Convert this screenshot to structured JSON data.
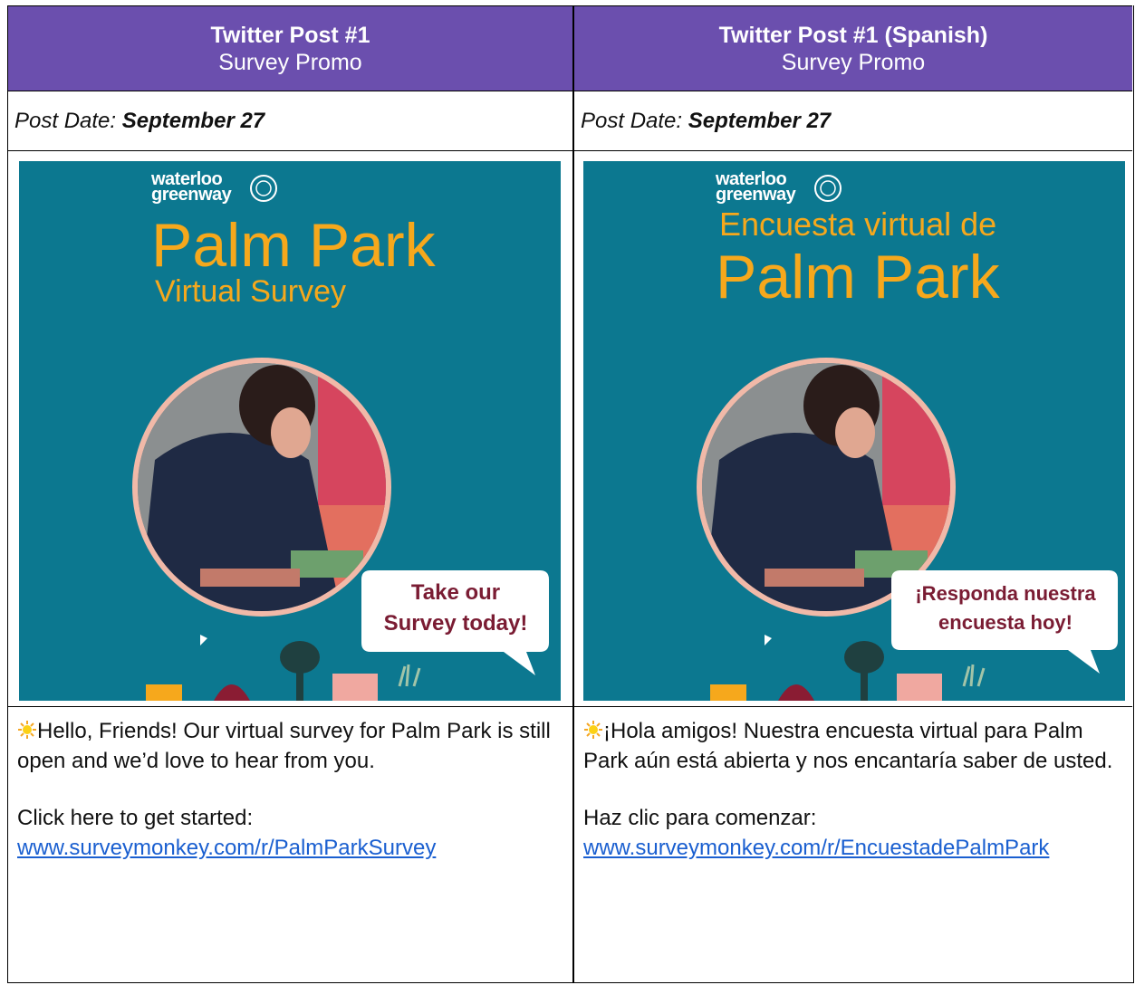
{
  "left": {
    "header_title": "Twitter Post #1",
    "header_subtitle": "Survey Promo",
    "date_label": "Post Date: ",
    "date_value": "September 27",
    "poster": {
      "brand_line1": "waterloo",
      "brand_line2": "greenway",
      "title_main": "Palm Park",
      "title_sub": "Virtual Survey",
      "bubble_line1": "Take our",
      "bubble_line2": "Survey today!"
    },
    "body_text": "Hello, Friends! Our virtual survey for Palm Park is still open and we’d love to hear from you.",
    "cta_text": "Click here to get started:",
    "link": "www.surveymonkey.com/r/PalmParkSurvey"
  },
  "right": {
    "header_title": "Twitter Post #1 (Spanish)",
    "header_subtitle": "Survey Promo",
    "date_label": "Post Date: ",
    "date_value": "September 27",
    "poster": {
      "brand_line1": "waterloo",
      "brand_line2": "greenway",
      "title_main": "Palm Park",
      "title_sub": "Encuesta virtual de",
      "bubble_line1": "¡Responda nuestra",
      "bubble_line2": "encuesta hoy!"
    },
    "body_text": "¡Hola amigos! Nuestra encuesta virtual para Palm Park aún está abierta y nos encantaría saber de usted.",
    "cta_text": "Haz clic para comenzar:",
    "link": "www.surveymonkey.com/r/EncuestadePalmPark"
  },
  "colors": {
    "header_bg": "#6b4fae",
    "poster_bg": "#0c7890",
    "poster_title": "#f6a81c",
    "bubble_text": "#7a1c33",
    "link": "#1a5fd0"
  },
  "icons": [
    "sun-emoji-icon",
    "city-seal-icon"
  ]
}
